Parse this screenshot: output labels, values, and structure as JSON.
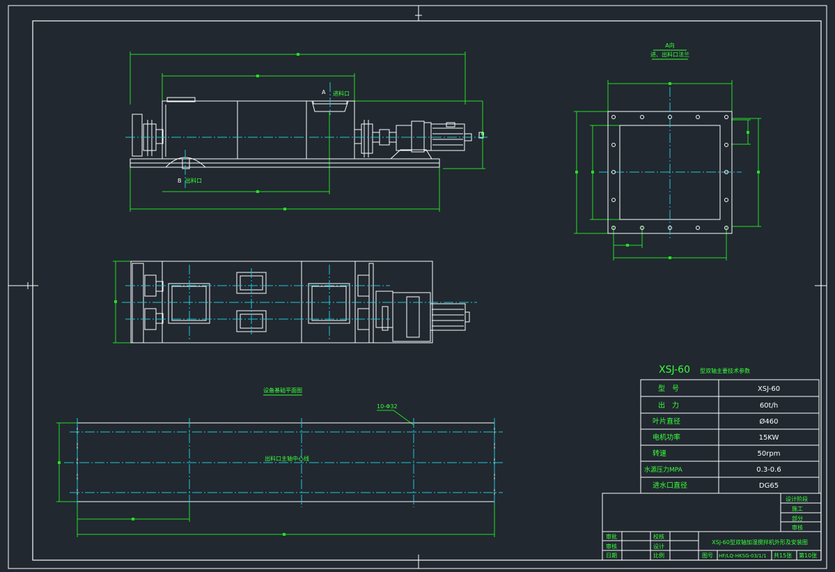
{
  "canvas": {
    "background": "#212830",
    "colors": {
      "frame": "#ffffff",
      "outline": "#ffffff",
      "dimension": "#22e022",
      "centerline": "#20c8d8",
      "text": "#39ff39"
    }
  },
  "elevation": {
    "feed_label": "进料口",
    "discharge_label": "出料口",
    "mark_a": "A",
    "mark_b": "B"
  },
  "flange_view": {
    "title": "A向",
    "subtitle": "进、出料口法兰"
  },
  "foundation": {
    "title": "设备基础平面图",
    "bolt_callout": "10-Φ32",
    "centerline_label": "出料口主轴中心线"
  },
  "spec_table": {
    "title_code": "XSJ-60",
    "title_rest": "型双轴主要技术参数",
    "rows": [
      {
        "label": "型　号",
        "value": "XSJ-60"
      },
      {
        "label": "出　力",
        "value": "60t/h"
      },
      {
        "label": "叶片直径",
        "value": "Ø460"
      },
      {
        "label": "电机功率",
        "value": "15KW"
      },
      {
        "label": "转速",
        "value": "50rpm"
      },
      {
        "label": "水源压力MPA",
        "value": "0.3-0.6"
      },
      {
        "label": "进水口直径",
        "value": "DG65"
      }
    ]
  },
  "title_block": {
    "stage_header": "设计阶段",
    "stages": [
      "施工",
      "部分",
      "审核"
    ],
    "roles": [
      {
        "left": "审批",
        "right": "校核"
      },
      {
        "left": "审核",
        "right": "设计"
      },
      {
        "left": "日期",
        "right": "比例"
      }
    ],
    "drawing_title": "XSJ-60型双轴加湿搅拌机外形及安装图",
    "drawing_no_label": "图号",
    "drawing_no": "HF/LQ-HKSG-03/1/1",
    "total_sheets": "共15张",
    "sheet_no": "第10张"
  }
}
